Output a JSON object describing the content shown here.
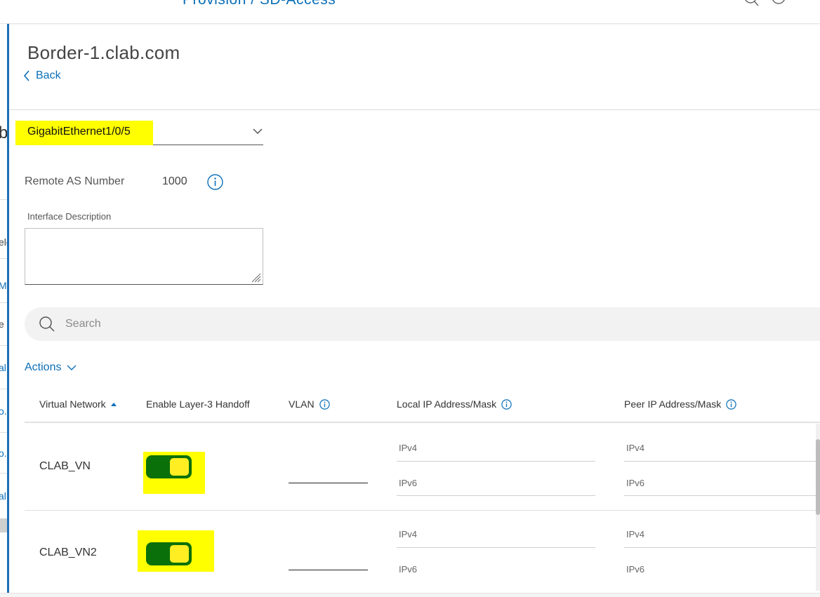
{
  "header": {
    "breadcrumb": "Provision / SD-Access",
    "icons": [
      "search-icon",
      "help-icon",
      "notifications-icon"
    ]
  },
  "left_panel": {
    "fragments": [
      "b",
      "ele",
      "M",
      "e",
      "al",
      "o.",
      "o.",
      "al"
    ]
  },
  "device": {
    "title": "Border-1.clab.com",
    "back_label": "Back"
  },
  "interface": {
    "selected": "GigabitEthernet1/0/5",
    "remote_as_label": "Remote AS Number",
    "remote_as_value": "1000",
    "description_label": "Interface Description",
    "description_value": ""
  },
  "search": {
    "placeholder": "Search"
  },
  "actions_label": "Actions",
  "table": {
    "columns": {
      "virtual_network": "Virtual Network",
      "enable_handoff": "Enable Layer-3 Handoff",
      "vlan": "VLAN",
      "local_ip": "Local IP Address/Mask",
      "peer_ip": "Peer IP Address/Mask"
    },
    "rows": [
      {
        "name": "CLAB_VN",
        "handoff_enabled": true,
        "vlan": "",
        "local_ipv4": "IPv4",
        "local_ipv6": "IPv6",
        "peer_ipv4": "IPv4",
        "peer_ipv6": "IPv6"
      },
      {
        "name": "CLAB_VN2",
        "handoff_enabled": true,
        "vlan": "",
        "local_ipv4": "IPv4",
        "local_ipv6": "IPv6",
        "peer_ipv4": "IPv4",
        "peer_ipv6": "IPv6"
      }
    ]
  },
  "colors": {
    "accent": "#0b6fb8",
    "toggle_on": "#0a700a",
    "highlight": "#ffff00"
  }
}
